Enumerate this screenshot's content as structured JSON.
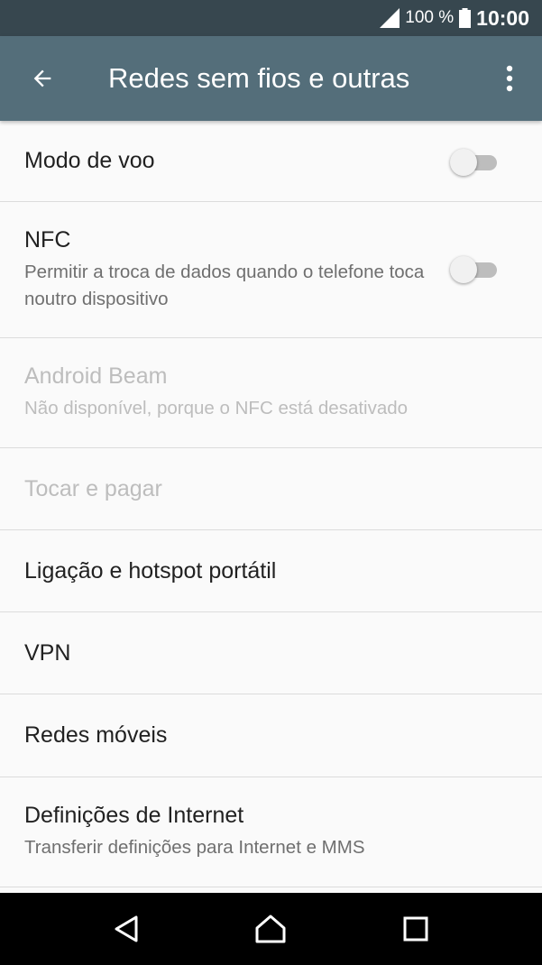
{
  "status_bar": {
    "battery_percent": "100 %",
    "time": "10:00",
    "icons": [
      "signal-icon",
      "battery-icon"
    ]
  },
  "app_bar": {
    "title": "Redes sem fios e outras",
    "icons": [
      "back-arrow-icon",
      "more-options-icon"
    ]
  },
  "items": [
    {
      "label": "Modo de voo",
      "toggle": "off"
    },
    {
      "label": "NFC",
      "summary": "Permitir a troca de dados quando o telefone toca noutro dispositivo",
      "toggle": "off"
    },
    {
      "label": "Android Beam",
      "summary": "Não disponível, porque o NFC está desativado",
      "disabled": true
    },
    {
      "label": "Tocar e pagar",
      "disabled": true
    },
    {
      "label": "Ligação e hotspot portátil"
    },
    {
      "label": "VPN"
    },
    {
      "label": "Redes móveis"
    },
    {
      "label": "Definições de Internet",
      "summary": "Transferir definições para Internet e MMS"
    }
  ],
  "nav_bar": {
    "icons": [
      "back-triangle-icon",
      "home-icon",
      "recents-icon"
    ]
  },
  "colors": {
    "status_bar": "#37474f",
    "app_bar": "#546e7a",
    "background": "#fafafa",
    "disabled_text": "#bdbdbd"
  }
}
